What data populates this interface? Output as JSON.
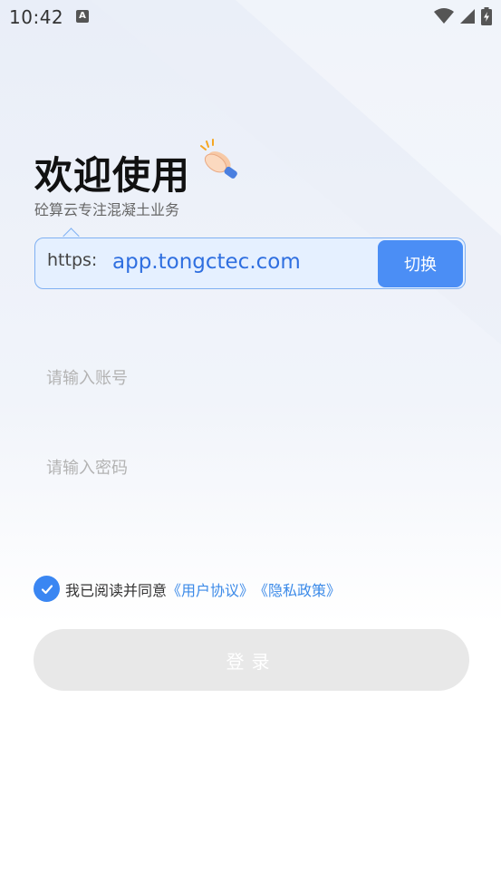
{
  "status_bar": {
    "time": "10:42",
    "notification_icon": "A"
  },
  "header": {
    "title": "欢迎使用",
    "subtitle": "砼算云专注混凝土业务",
    "emoji_icon": "clapping-hands-icon"
  },
  "server": {
    "protocol": "https:",
    "address": "app.tongctec.com",
    "switch_label": "切换"
  },
  "form": {
    "account_placeholder": "请输入账号",
    "password_placeholder": "请输入密码"
  },
  "agreement": {
    "prefix": "我已阅读并同意",
    "user_agreement": "《用户协议》",
    "privacy_policy": "《隐私政策》",
    "checked": true
  },
  "login": {
    "label": "登录"
  },
  "colors": {
    "accent": "#4b8ef5",
    "link": "#3b8ae8",
    "disabled_button": "#e8e8e8"
  }
}
